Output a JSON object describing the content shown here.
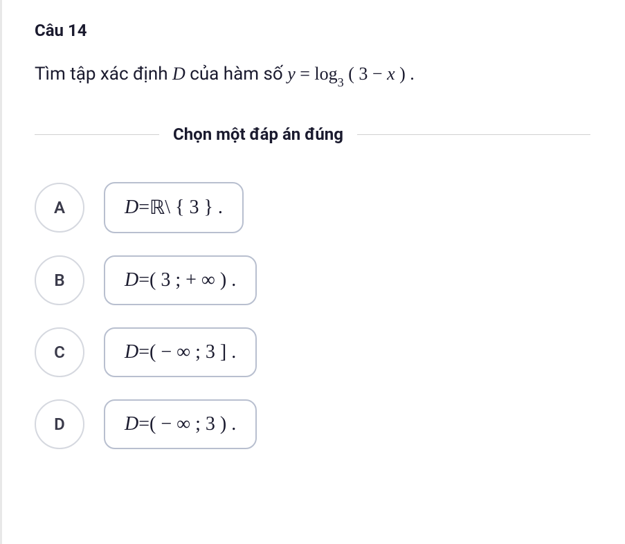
{
  "question": {
    "number": "Câu 14",
    "text_prefix": "Tìm tập xác định ",
    "var_D": "D",
    "text_mid": " của hàm số ",
    "formula_y": "y",
    "formula_eq": " = ",
    "formula_log": "log",
    "formula_base": "3",
    "formula_arg_open": " ( ",
    "formula_arg_3": "3",
    "formula_arg_minus": " − ",
    "formula_arg_x": "x",
    "formula_arg_close": " ) .",
    "instruction": "Chọn một đáp án đúng"
  },
  "options": {
    "a": {
      "letter": "A",
      "D": "D",
      "eq": " = ",
      "R": "ℝ",
      "rest": " \\ { 3 } ."
    },
    "b": {
      "letter": "B",
      "D": "D",
      "eq": " = ",
      "rest": "( 3 ; + ∞ ) ."
    },
    "c": {
      "letter": "C",
      "D": "D",
      "eq": " = ",
      "rest": "( − ∞ ; 3 ] ."
    },
    "d": {
      "letter": "D",
      "D": "D",
      "eq": " = ",
      "rest": "( − ∞ ; 3 ) ."
    }
  }
}
